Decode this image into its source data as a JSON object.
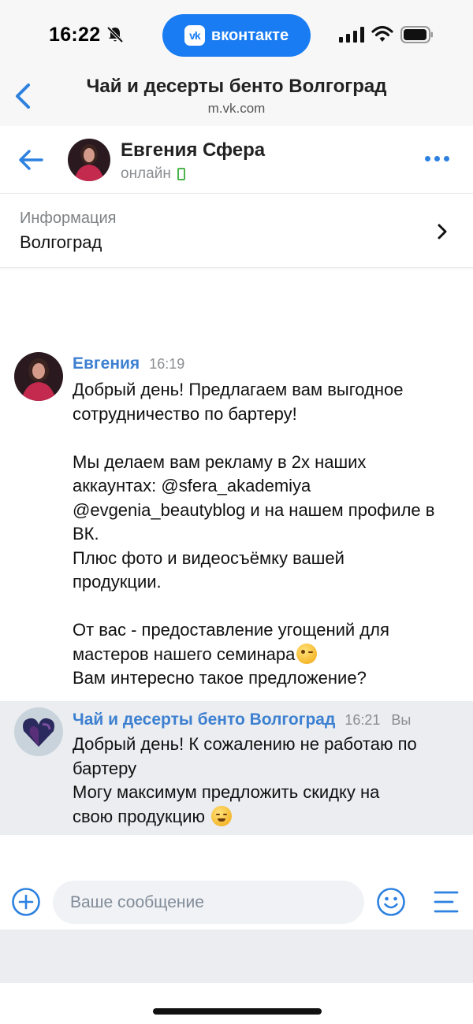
{
  "status_bar": {
    "time": "16:22",
    "app_pill_label": "вконтакте",
    "app_pill_logo": "vk"
  },
  "browser": {
    "title": "Чай и десерты бенто Волгоград",
    "url": "m.vk.com"
  },
  "chat_header": {
    "contact_name": "Евгения Сфера",
    "status": "онлайн"
  },
  "info": {
    "label": "Информация",
    "value": "Волгоград"
  },
  "messages": [
    {
      "author": "Евгения",
      "time": "16:19",
      "lines": [
        "Добрый день! Предлагаем вам выгодное",
        "сотрудничество по бартеру!",
        "",
        "Мы делаем вам рекламу в 2х наших",
        "аккаунтах: @sfera_akademiya",
        "@evgenia_beautyblog и на нашем профиле в",
        "ВК.",
        "Плюс фото и видеосъёмку вашей",
        "продукции.",
        "",
        "От вас - предоставление угощений для",
        "мастеров нашего семинара",
        "Вам интересно такое предложение?"
      ]
    },
    {
      "author": "Чай и десерты бенто Волгоград",
      "time": "16:21",
      "you_label": "Вы",
      "lines": [
        "Добрый день! К сожалению не работаю по",
        "бартеру",
        "Могу максимум предложить скидку на",
        "свою продукцию "
      ]
    }
  ],
  "composer": {
    "placeholder": "Ваше сообщение"
  },
  "colors": {
    "accent": "#2d81e0",
    "author_link": "#3d80d1",
    "vk_blue": "#1a7cf2",
    "online_green": "#4bb34b",
    "highlight_bg": "#ebedf0"
  }
}
